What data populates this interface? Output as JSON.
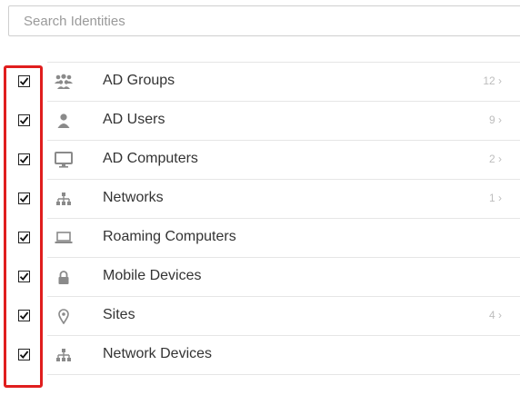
{
  "search": {
    "placeholder": "Search Identities"
  },
  "items": [
    {
      "label": "AD Groups",
      "count": "12 ›",
      "checked": true,
      "icon": "users-group-icon"
    },
    {
      "label": "AD Users",
      "count": "9 ›",
      "checked": true,
      "icon": "user-icon"
    },
    {
      "label": "AD Computers",
      "count": "2 ›",
      "checked": true,
      "icon": "monitor-icon"
    },
    {
      "label": "Networks",
      "count": "1 ›",
      "checked": true,
      "icon": "network-icon"
    },
    {
      "label": "Roaming Computers",
      "count": "",
      "checked": true,
      "icon": "laptop-icon"
    },
    {
      "label": "Mobile Devices",
      "count": "",
      "checked": true,
      "icon": "lock-icon"
    },
    {
      "label": "Sites",
      "count": "4 ›",
      "checked": true,
      "icon": "map-pin-icon"
    },
    {
      "label": "Network Devices",
      "count": "",
      "checked": true,
      "icon": "network-device-icon"
    }
  ],
  "colors": {
    "highlight": "#e01e1e",
    "icon": "#8a8a8a",
    "count": "#bdbdbd"
  }
}
